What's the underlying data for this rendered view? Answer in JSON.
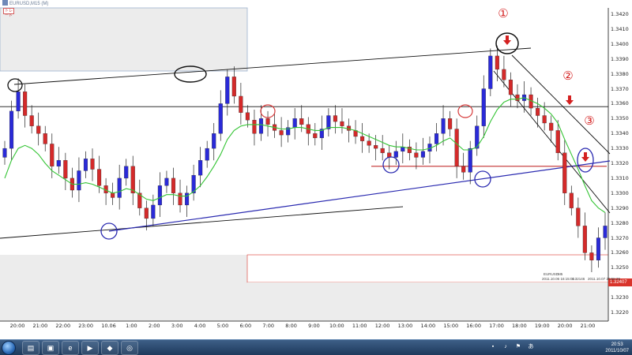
{
  "window": {
    "title": "EURUSD,M15 (M)",
    "toolbar_icon_text": "トレード"
  },
  "price_axis": {
    "labels": [
      "1.3420",
      "1.3410",
      "1.3400",
      "1.3390",
      "1.3380",
      "1.3370",
      "1.3360",
      "1.3350",
      "1.3340",
      "1.3330",
      "1.3320",
      "1.3310",
      "1.3300",
      "1.3290",
      "1.3280",
      "1.3270",
      "1.3260",
      "1.3250",
      "1.3240",
      "1.3230",
      "1.3220"
    ],
    "current_price": "1.32407"
  },
  "time_axis": {
    "labels": [
      "20:00",
      "21:00",
      "22:00",
      "23:00",
      "10.06",
      "1:00",
      "2:00",
      "3:00",
      "4:00",
      "5:00",
      "6:00",
      "7:00",
      "8:00",
      "9:00",
      "10:00",
      "11:00",
      "12:00",
      "13:00",
      "14:00",
      "15:00",
      "16:00",
      "17:00",
      "18:00",
      "19:00",
      "20:00",
      "21:00"
    ]
  },
  "annotations": {
    "markers": [
      "①",
      "②",
      "③"
    ]
  },
  "status_line": {
    "symbol": "EURUSD",
    "timeframe": "M5",
    "text_left": "2011.10.06 16:15:00",
    "text_mid": "1.32146",
    "text_right": "2011.10.07 20:55:39"
  },
  "taskbar": {
    "clock_time": "20:53",
    "clock_date": "2011/10/07"
  },
  "chart_data": {
    "type": "candlestick",
    "symbol": "EURUSD",
    "timeframe": "M15",
    "ylim": [
      1.3215,
      1.3425
    ],
    "series": [
      {
        "name": "price",
        "values": [
          1.333,
          1.3355,
          1.3368,
          1.3352,
          1.3345,
          1.334,
          1.3333,
          1.3318,
          1.3322,
          1.331,
          1.3302,
          1.3315,
          1.3323,
          1.3316,
          1.3305,
          1.33,
          1.3297,
          1.331,
          1.3318,
          1.33,
          1.329,
          1.3283,
          1.3292,
          1.3305,
          1.331,
          1.33,
          1.3292,
          1.33,
          1.3312,
          1.3322,
          1.333,
          1.334,
          1.336,
          1.3378,
          1.3365,
          1.3354,
          1.3349,
          1.334,
          1.335,
          1.3346,
          1.3342,
          1.3339,
          1.3344,
          1.335,
          1.3346,
          1.334,
          1.3337,
          1.3343,
          1.3352,
          1.3348,
          1.3345,
          1.3342,
          1.3338,
          1.3335,
          1.3332,
          1.333,
          1.3327,
          1.3324,
          1.3328,
          1.3331,
          1.3327,
          1.3324,
          1.3328,
          1.3333,
          1.334,
          1.335,
          1.3343,
          1.3318,
          1.3314,
          1.333,
          1.3345,
          1.337,
          1.3392,
          1.3383,
          1.3376,
          1.3366,
          1.3362,
          1.3366,
          1.3357,
          1.3352,
          1.3347,
          1.3342,
          1.3327,
          1.33,
          1.329,
          1.3278,
          1.326,
          1.3255,
          1.327,
          1.3278
        ]
      },
      {
        "name": "ma",
        "values": [
          1.331,
          1.3322,
          1.333,
          1.3332,
          1.333,
          1.3326,
          1.332,
          1.3315,
          1.3312,
          1.3309,
          1.3306,
          1.3306,
          1.3307,
          1.3306,
          1.3304,
          1.3302,
          1.33,
          1.3301,
          1.3303,
          1.3302,
          1.3299,
          1.3296,
          1.3295,
          1.3297,
          1.3299,
          1.3299,
          1.3298,
          1.3298,
          1.3301,
          1.3305,
          1.3311,
          1.3318,
          1.3326,
          1.3336,
          1.3342,
          1.3345,
          1.3346,
          1.3346,
          1.3346,
          1.3345,
          1.3344,
          1.3343,
          1.3343,
          1.3344,
          1.3344,
          1.3343,
          1.3342,
          1.3342,
          1.3344,
          1.3344,
          1.3344,
          1.3343,
          1.3342,
          1.334,
          1.3338,
          1.3336,
          1.3334,
          1.3332,
          1.3331,
          1.3331,
          1.333,
          1.3329,
          1.3329,
          1.333,
          1.3332,
          1.3335,
          1.3337,
          1.3333,
          1.3329,
          1.3329,
          1.3331,
          1.3338,
          1.3348,
          1.3356,
          1.3361,
          1.3363,
          1.3363,
          1.3364,
          1.3362,
          1.336,
          1.3357,
          1.3353,
          1.3347,
          1.3336,
          1.3326,
          1.3316,
          1.3305,
          1.3295,
          1.329,
          1.3287
        ]
      }
    ],
    "horizontal_lines": [
      1.3358,
      1.3318
    ],
    "grid": true
  }
}
